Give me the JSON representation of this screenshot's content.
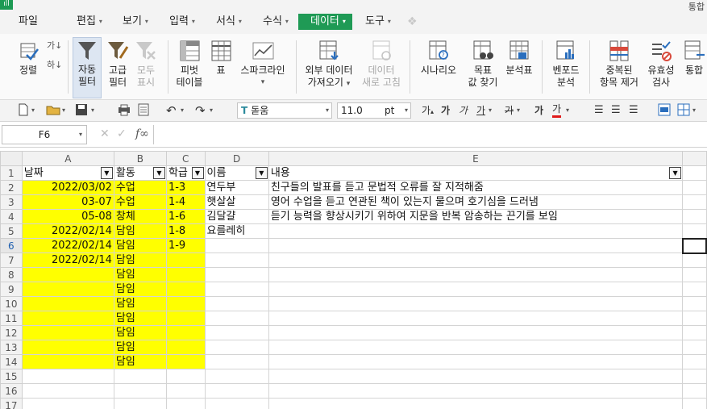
{
  "topbar": {
    "corner_text": "통합",
    "menus": [
      {
        "label": "파일",
        "has_arrow": false
      },
      {
        "label": "편집",
        "has_arrow": true
      },
      {
        "label": "보기",
        "has_arrow": true
      },
      {
        "label": "입력",
        "has_arrow": true
      },
      {
        "label": "서식",
        "has_arrow": true
      },
      {
        "label": "수식",
        "has_arrow": true
      },
      {
        "label": "데이터",
        "has_arrow": true,
        "active": true
      },
      {
        "label": "도구",
        "has_arrow": true
      }
    ],
    "arrow": "▾"
  },
  "ribbon": {
    "sort_label": "정렬",
    "autofilter_label_1": "자동",
    "autofilter_label_2": "필터",
    "advfilter_label_1": "고급",
    "advfilter_label_2": "필터",
    "showall_label_1": "모두",
    "showall_label_2": "표시",
    "pivot_label_1": "피벗",
    "pivot_label_2": "테이블",
    "table_label": "표",
    "sparkline_label": "스파크라인",
    "external_label_1": "외부 데이터",
    "external_label_2": "가져오기",
    "refresh_label_1": "데이터",
    "refresh_label_2": "새로 고침",
    "scenario_label": "시나리오",
    "goalseek_label_1": "목표",
    "goalseek_label_2": "값 찾기",
    "analysis_label": "분석표",
    "benford_label_1": "벤포드",
    "benford_label_2": "분석",
    "dedupe_label_1": "중복된",
    "dedupe_label_2": "항목 제거",
    "validation_label_1": "유효성",
    "validation_label_2": "검사",
    "consolidate_label": "통합",
    "dropdown_glyph": "▾"
  },
  "format_toolbar": {
    "font_name": "돋움",
    "font_size": "11.0",
    "size_unit": "pt",
    "glyphs": {
      "bold_ga": "가",
      "italic_ga": "가",
      "underline_ga": "가",
      "strike_ga": "가",
      "font_grow": "가",
      "font_color_ga": "가",
      "t_icon": "T"
    }
  },
  "formula_bar": {
    "name_box": "F6",
    "fx_label": "f∞",
    "formula_value": "",
    "cancel_icon": "✕",
    "enter_icon": "✓"
  },
  "sheet": {
    "columns": [
      "A",
      "B",
      "C",
      "D",
      "E"
    ],
    "filter_glyph": "▼",
    "rows": [
      {
        "num": "1",
        "cells": [
          "날짜",
          "활동",
          "학급",
          "이름",
          "내용"
        ]
      },
      {
        "num": "2",
        "cells": [
          "2022/03/02",
          "수업",
          "1-3",
          "연두부",
          "친구들의 발표를 듣고 문법적 오류를 잘 지적해줌"
        ]
      },
      {
        "num": "3",
        "cells": [
          "03-07",
          "수업",
          "1-4",
          "햇살살",
          "영어 수업을 듣고 연관된 책이 있는지 물으며 호기심을 드러냄"
        ]
      },
      {
        "num": "4",
        "cells": [
          "05-08",
          "창체",
          "1-6",
          "김달걀",
          "듣기 능력을 향상시키기 위하여 지문을 반복 암송하는 끈기를 보임"
        ]
      },
      {
        "num": "5",
        "cells": [
          "2022/02/14",
          "담임",
          "1-8",
          "요를레히",
          ""
        ]
      },
      {
        "num": "6",
        "cells": [
          "2022/02/14",
          "담임",
          "1-9",
          "",
          ""
        ]
      },
      {
        "num": "7",
        "cells": [
          "2022/02/14",
          "담임",
          "",
          "",
          ""
        ]
      },
      {
        "num": "8",
        "cells": [
          "",
          "담임",
          "",
          "",
          ""
        ]
      },
      {
        "num": "9",
        "cells": [
          "",
          "담임",
          "",
          "",
          ""
        ]
      },
      {
        "num": "10",
        "cells": [
          "",
          "담임",
          "",
          "",
          ""
        ]
      },
      {
        "num": "11",
        "cells": [
          "",
          "담임",
          "",
          "",
          ""
        ]
      },
      {
        "num": "12",
        "cells": [
          "",
          "담임",
          "",
          "",
          ""
        ]
      },
      {
        "num": "13",
        "cells": [
          "",
          "담임",
          "",
          "",
          ""
        ]
      },
      {
        "num": "14",
        "cells": [
          "",
          "담임",
          "",
          "",
          ""
        ]
      },
      {
        "num": "15",
        "cells": [
          "",
          "",
          "",
          "",
          ""
        ]
      },
      {
        "num": "16",
        "cells": [
          "",
          "",
          "",
          "",
          ""
        ]
      },
      {
        "num": "17",
        "cells": [
          "",
          "",
          "",
          "",
          ""
        ]
      }
    ]
  },
  "colors": {
    "accent_green": "#1f9a55",
    "highlight_yellow": "#ffff00",
    "active_row_blue": "#1f5fb0"
  }
}
